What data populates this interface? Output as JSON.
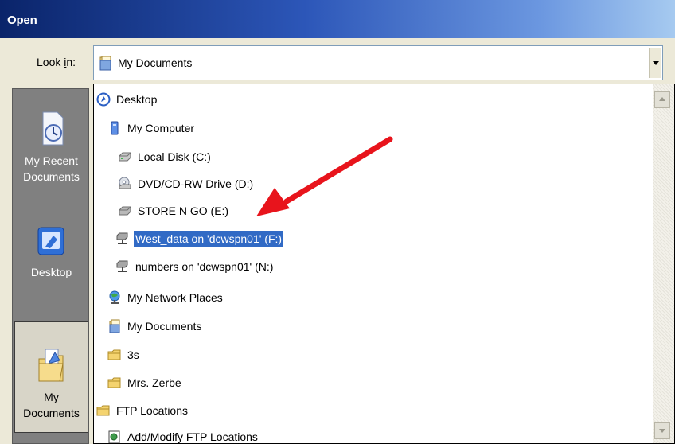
{
  "window": {
    "title": "Open"
  },
  "look_in": {
    "label_prefix": "Look ",
    "label_accel": "i",
    "label_suffix": "n:",
    "value": "My Documents"
  },
  "places": [
    {
      "label_line1": "My Recent",
      "label_line2": "Documents",
      "icon": "recent-documents-icon"
    },
    {
      "label_line1": "Desktop",
      "icon": "desktop-icon"
    },
    {
      "label_line1": "My Documents",
      "icon": "my-documents-icon",
      "selected": true
    }
  ],
  "tree": [
    {
      "label": "Desktop",
      "icon": "desktop-icon"
    },
    {
      "label": "My Computer",
      "icon": "computer-icon"
    },
    {
      "label": "Local Disk (C:)",
      "icon": "hard-disk-icon"
    },
    {
      "label": "DVD/CD-RW Drive (D:)",
      "icon": "dvd-drive-icon"
    },
    {
      "label": "STORE N GO (E:)",
      "icon": "removable-disk-icon"
    },
    {
      "label": "West_data on 'dcwspn01' (F:)",
      "icon": "network-drive-icon",
      "selected": true
    },
    {
      "label": "numbers on 'dcwspn01' (N:)",
      "icon": "network-drive-icon"
    },
    {
      "label": "My Network Places",
      "icon": "network-places-icon"
    },
    {
      "label": "My Documents",
      "icon": "my-documents-icon"
    },
    {
      "label": "3s",
      "icon": "folder-icon"
    },
    {
      "label": "Mrs. Zerbe",
      "icon": "folder-icon"
    },
    {
      "label": "FTP Locations",
      "icon": "folder-icon"
    },
    {
      "label": "Add/Modify FTP Locations",
      "icon": "ftp-add-icon"
    }
  ],
  "colors": {
    "title_gradient_start": "#0a246a",
    "selection": "#316ac5",
    "annotation_arrow": "#e8141c"
  }
}
